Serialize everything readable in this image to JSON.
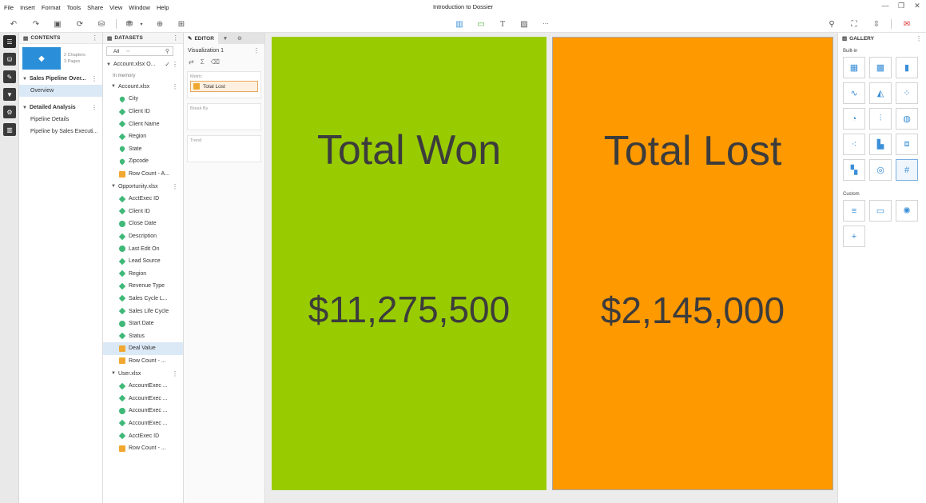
{
  "window": {
    "title": "Introduction to Dossier",
    "menus": [
      "File",
      "Insert",
      "Format",
      "Tools",
      "Share",
      "View",
      "Window",
      "Help"
    ]
  },
  "contents": {
    "header": "CONTENTS",
    "thumb_line1": "2 Chapters",
    "thumb_line2": "3 Pages",
    "chapters": [
      {
        "title": "Sales Pipeline Over...",
        "pages": [
          "Overview"
        ]
      },
      {
        "title": "Detailed Analysis",
        "pages": [
          "Pipeline Details",
          "Pipeline by Sales Executi..."
        ]
      }
    ]
  },
  "datasets": {
    "header": "DATASETS",
    "filter_value": "All",
    "dataset_name": "Account.xlsx O...",
    "in_memory": "In memory",
    "groups": [
      {
        "name": "Account.xlsx",
        "items": [
          {
            "label": "City",
            "icon": "geo"
          },
          {
            "label": "Client ID",
            "icon": "attr"
          },
          {
            "label": "Client Name",
            "icon": "attr"
          },
          {
            "label": "Region",
            "icon": "attr"
          },
          {
            "label": "State",
            "icon": "geo"
          },
          {
            "label": "Zipcode",
            "icon": "geo"
          },
          {
            "label": "Row Count - A...",
            "icon": "metric"
          }
        ]
      },
      {
        "name": "Opportunity.xlsx",
        "items": [
          {
            "label": "AcctExec ID",
            "icon": "attr"
          },
          {
            "label": "Client ID",
            "icon": "attr"
          },
          {
            "label": "Close Date",
            "icon": "date"
          },
          {
            "label": "Description",
            "icon": "attr"
          },
          {
            "label": "Last Edit On",
            "icon": "date"
          },
          {
            "label": "Lead Source",
            "icon": "attr"
          },
          {
            "label": "Region",
            "icon": "attr"
          },
          {
            "label": "Revenue Type",
            "icon": "attr"
          },
          {
            "label": "Sales Cycle L...",
            "icon": "attr"
          },
          {
            "label": "Sales Life Cycle",
            "icon": "attr"
          },
          {
            "label": "Start Date",
            "icon": "date"
          },
          {
            "label": "Status",
            "icon": "attr"
          },
          {
            "label": "Deal Value",
            "icon": "metric",
            "selected": true
          },
          {
            "label": "Row Count - ...",
            "icon": "metric"
          }
        ]
      },
      {
        "name": "User.xlsx",
        "items": [
          {
            "label": "AccountExec ...",
            "icon": "attr"
          },
          {
            "label": "AccountExec ...",
            "icon": "attr"
          },
          {
            "label": "AccountExec ...",
            "icon": "date"
          },
          {
            "label": "AccountExec ...",
            "icon": "attr"
          },
          {
            "label": "AcctExec ID",
            "icon": "attr"
          },
          {
            "label": "Row Count - ...",
            "icon": "metric"
          }
        ]
      }
    ]
  },
  "editor": {
    "tab_label": "EDITOR",
    "vis_name": "Visualization 1",
    "zones": {
      "metric_label": "Metric",
      "metric_chip": "Total Lost",
      "breakby_label": "Break By",
      "trend_label": "Trend"
    }
  },
  "canvas": {
    "tiles": [
      {
        "name": "Total Won",
        "value": "$11,275,500",
        "color": "#99cc00"
      },
      {
        "name": "Total Lost",
        "value": "$2,145,000",
        "color": "#ff9900"
      }
    ]
  },
  "gallery": {
    "header": "GALLERY",
    "builtin_label": "Built-in",
    "custom_label": "Custom",
    "builtin_icons": [
      "grid-icon",
      "heatmap-icon",
      "bar-chart-icon",
      "line-chart-icon",
      "area-chart-icon",
      "bubble-chart-icon",
      "pie-chart-icon",
      "combo-chart-icon",
      "map-icon",
      "scatter-icon",
      "histogram-icon",
      "box-plot-icon",
      "waterfall-icon",
      "geo-map-icon",
      "kpi-icon"
    ],
    "custom_icons": [
      "custom-viz-1-icon",
      "custom-viz-2-icon",
      "custom-viz-3-icon",
      "add-custom-icon"
    ]
  }
}
